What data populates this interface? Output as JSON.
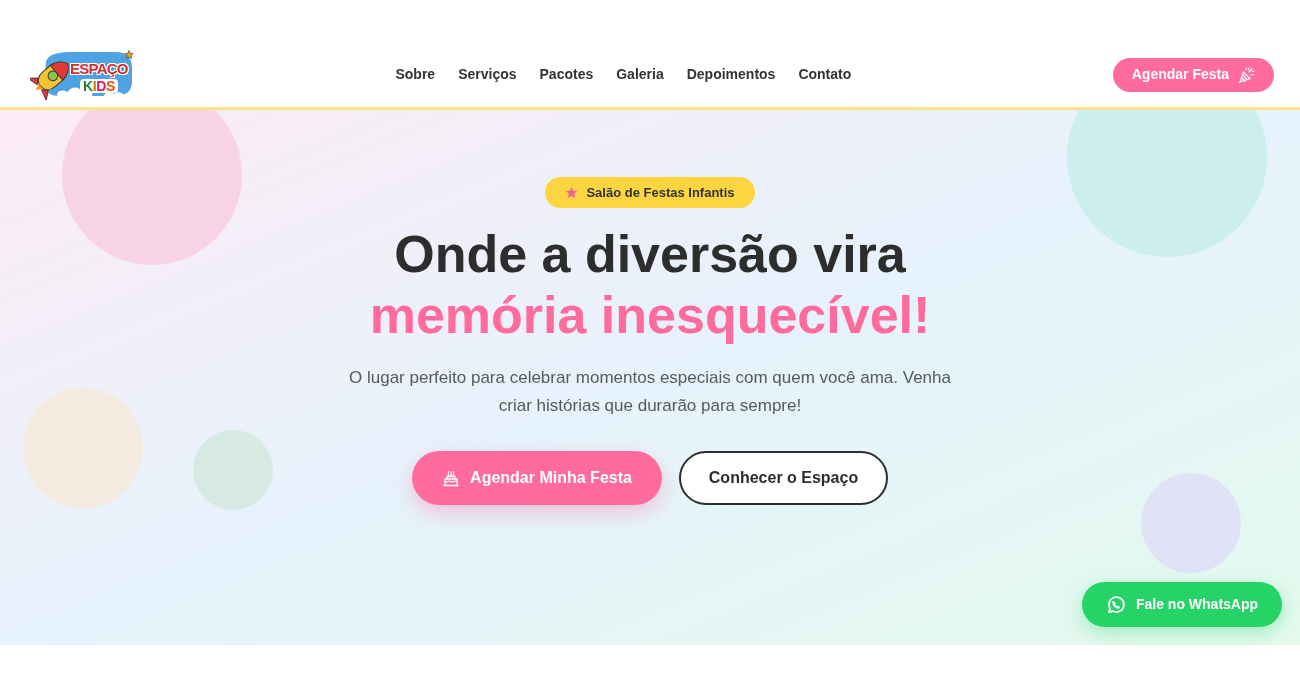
{
  "header": {
    "logo": {
      "title": "ESPAÇO",
      "subtitle": "KIDS"
    },
    "nav": [
      "Sobre",
      "Serviços",
      "Pacotes",
      "Galeria",
      "Depoimentos",
      "Contato"
    ],
    "cta": {
      "label": "Agendar Festa"
    }
  },
  "hero": {
    "badge": "Salão de Festas Infantis",
    "title": {
      "line_1": "Onde a diversão vira",
      "highlight": "memória inesquecível!"
    },
    "description": "O lugar perfeito para celebrar momentos especiais com quem você ama. Venha criar histórias que durarão para sempre!",
    "buttons": [
      {
        "label": "Agendar Minha Festa",
        "kind": "primary"
      },
      {
        "label": "Conhecer o Espaço",
        "kind": "outline"
      }
    ]
  },
  "whatsapp_button": {
    "label": "Fale no WhatsApp"
  }
}
